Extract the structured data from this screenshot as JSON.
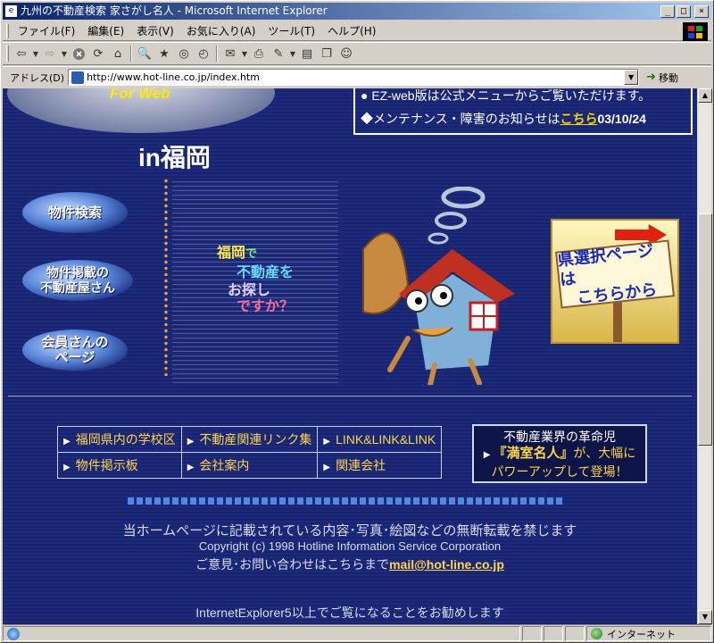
{
  "window": {
    "title": "九州の不動産検索 家さがし名人 - Microsoft Internet Explorer",
    "controls": {
      "minimize": "_",
      "maximize": "□",
      "close": "×"
    }
  },
  "menu": [
    "ファイル(F)",
    "編集(E)",
    "表示(V)",
    "お気に入り(A)",
    "ツール(T)",
    "ヘルプ(H)"
  ],
  "address": {
    "label": "アドレス(D)",
    "url": "http://www.hot-line.co.jp/index.htm",
    "go_label": "移動"
  },
  "page": {
    "header_notice_line1": "● EZ-web版は公式メニューからご覧いただけます。",
    "maintenance": {
      "prefix": "◆メンテナンス・障害のお知らせは",
      "link": "こちら",
      "date": "03/10/24"
    },
    "logo_text": "For Web",
    "region_heading": "in福岡",
    "nav": [
      {
        "label": "物件検索"
      },
      {
        "label": "物件掲載の 不動産屋さん"
      },
      {
        "label": "会員さんの ページ"
      }
    ],
    "fukuoka_text": {
      "l1a": "福岡",
      "l1b": "で",
      "l2": "不動産を",
      "l3": "お探し",
      "l4": "ですか？"
    },
    "pref_select": {
      "line1": "県選択ページは",
      "line2": "こちらから"
    },
    "links": [
      [
        "福岡県内の学校区",
        "不動産関連リンク集",
        "LINK&LINK&LINK"
      ],
      [
        "物件掲示板",
        "会社案内",
        "関連会社"
      ]
    ],
    "revolution": {
      "line1": "不動産業界の革命児",
      "name": "『満室名人』",
      "line2_suffix": "が、大幅に",
      "line3": "パワーアップして登場！"
    },
    "footer": {
      "notice": "当ホームページに記載されている内容･写真･絵図などの無断転載を禁じます",
      "copyright": "Copyright (c) 1998 Hotline Information Service Corporation",
      "contact_prefix": "ご意見･お問い合わせはこちらまで",
      "email": "mail@hot-line.co.jp",
      "recommend": "InternetExplorer5以上でご覧になることをお勧めします"
    }
  },
  "status": {
    "text": "",
    "zone": "インターネット"
  },
  "colors": {
    "page_bg": "#1c2b7d",
    "link_yellow": "#ffd54a",
    "title_blue": "#0a246a"
  }
}
